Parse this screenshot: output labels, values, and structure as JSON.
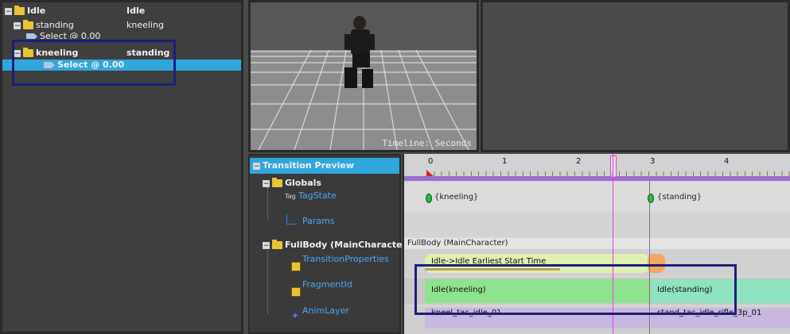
{
  "tree": {
    "rows": [
      {
        "name": "Idle",
        "value": "Idle"
      },
      {
        "name": "standing",
        "value": "kneeling"
      },
      {
        "name": "Select @ 0.00",
        "value": ""
      },
      {
        "name": "kneeling",
        "value": "standing"
      },
      {
        "name": "Select @ 0.00",
        "value": ""
      }
    ]
  },
  "viewport": {
    "label": "Timeline: Seconds"
  },
  "labels": {
    "transition_preview": "Transition Preview",
    "globals": "Globals",
    "tag_prefix": "Tag",
    "tagstate": "TagState",
    "params": "Params",
    "fullbody": "FullBody (MainCharacter)",
    "transition_properties": "TransitionProperties",
    "fragment_id": "FragmentId",
    "anim_layer": "AnimLayer"
  },
  "timeline": {
    "ruler": [
      "0",
      "1",
      "2",
      "3",
      "4"
    ],
    "tag_kneeling": "{kneeling}",
    "tag_standing": "{standing}",
    "fullbody_header": "FullBody (MainCharacter)",
    "transition_clip": "Idle->Idle Earliest Start Time",
    "fragment_left": "Idle(kneeling)",
    "fragment_right": "Idle(standing)",
    "anim_left": "kneel_tac_idle_01",
    "anim_right": "stand_tac_idle_rifle_3p_01"
  }
}
